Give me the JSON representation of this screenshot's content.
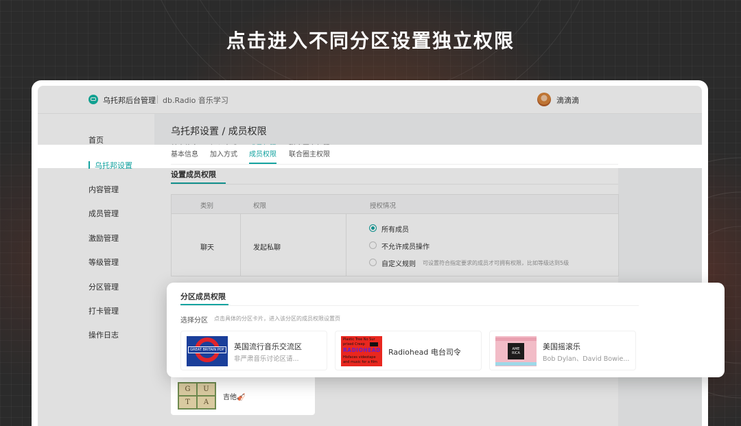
{
  "headline": "点击进入不同分区设置独立权限",
  "topbar": {
    "app_name": "乌托邦后台管理",
    "workspace_name": "db.Radio 音乐学习",
    "username": "滴滴滴"
  },
  "sidebar": {
    "items": [
      {
        "label": "首页"
      },
      {
        "label": "乌托邦设置"
      },
      {
        "label": "内容管理"
      },
      {
        "label": "成员管理"
      },
      {
        "label": "激励管理"
      },
      {
        "label": "等级管理"
      },
      {
        "label": "分区管理"
      },
      {
        "label": "打卡管理"
      },
      {
        "label": "操作日志"
      }
    ],
    "active_index": 1
  },
  "page": {
    "title": "乌托邦设置 / 成员权限",
    "tabs": [
      {
        "label": "基本信息"
      },
      {
        "label": "加入方式"
      },
      {
        "label": "成员权限"
      },
      {
        "label": "联合圈主权限"
      }
    ],
    "active_tab": 2
  },
  "member_permissions": {
    "section_title": "设置成员权限",
    "headers": [
      "类别",
      "权限",
      "授权情况"
    ],
    "row": {
      "category": "聊天",
      "permission": "发起私聊",
      "options": [
        {
          "label": "所有成员",
          "checked": true
        },
        {
          "label": "不允许成员操作",
          "checked": false
        },
        {
          "label": "自定义规则",
          "checked": false,
          "hint": "可设置符合指定要求的成员才可拥有权限，比如等级达到5级"
        }
      ]
    }
  },
  "zone_popup": {
    "title": "分区成员权限",
    "subtitle": "选择分区",
    "hint": "点击具体的分区卡片，进入该分区的成员权限设置页",
    "zones": [
      {
        "name": "英国流行音乐交流区",
        "desc": "非严肃音乐讨论区请...",
        "thumb_text": "GREAT BRITAIN POP"
      },
      {
        "name": "Radiohead 电台司令",
        "desc": "",
        "thumb_lines": [
          "Plastic Tree No Sur",
          "prised Creep",
          "RADIOHEAD",
          "Hisfaces videotape",
          "and music for a film"
        ]
      },
      {
        "name": "美国摇滚乐",
        "desc": "Bob Dylan、David Bowie...",
        "thumb_text": "AME RICA"
      }
    ]
  },
  "guitar_zone": {
    "label": "吉他🎻",
    "thumb_letters": [
      "G",
      "U",
      "T",
      "A"
    ]
  },
  "colors": {
    "accent": "#14a3a0",
    "background": "#2b2b2b"
  }
}
